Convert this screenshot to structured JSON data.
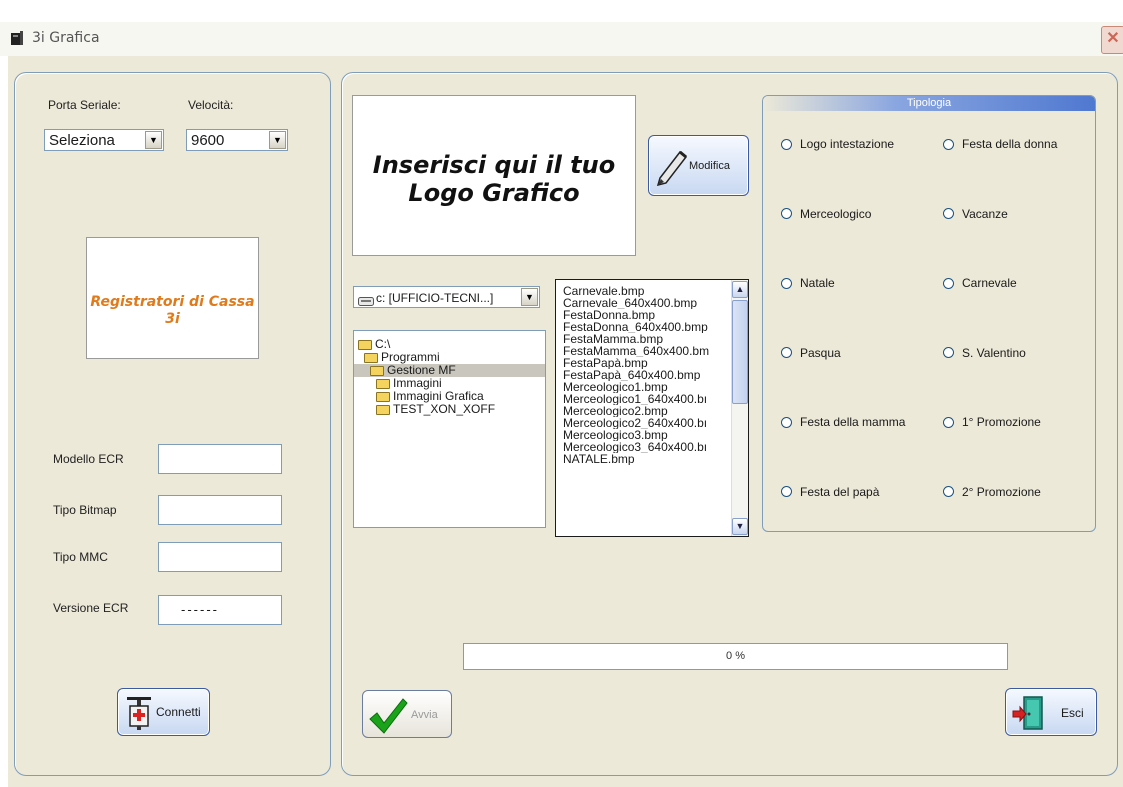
{
  "window": {
    "title": "3i Grafica",
    "close_glyph": "✕"
  },
  "connection": {
    "port_label": "Porta Seriale:",
    "port_value": "Seleziona",
    "speed_label": "Velocità:",
    "speed_value": "9600"
  },
  "brand": {
    "text": "Registratori di Cassa 3i"
  },
  "device_info": {
    "modello_label": "Modello ECR",
    "modello_value": "",
    "bitmap_label": "Tipo Bitmap",
    "bitmap_value": "",
    "mmc_label": "Tipo MMC",
    "mmc_value": "",
    "versione_label": "Versione ECR",
    "versione_value": "------"
  },
  "buttons": {
    "connetti": "Connetti",
    "modifica": "Modifica",
    "avvia": "Avvia",
    "esci": "Esci"
  },
  "logo_preview": {
    "line1": "Inserisci qui il tuo",
    "line2": "Logo Grafico"
  },
  "drive": {
    "value": "c: [UFFICIO-TECNI...]"
  },
  "folders": [
    {
      "label": "C:\\",
      "level": 0,
      "open": true
    },
    {
      "label": "Programmi",
      "level": 1,
      "open": true
    },
    {
      "label": "Gestione MF",
      "level": 2,
      "open": true,
      "selected": true
    },
    {
      "label": "Immagini",
      "level": 3,
      "open": false
    },
    {
      "label": "Immagini Grafica",
      "level": 3,
      "open": false
    },
    {
      "label": "TEST_XON_XOFF",
      "level": 3,
      "open": false
    }
  ],
  "files": [
    "Carnevale.bmp",
    "Carnevale_640x400.bmp",
    "FestaDonna.bmp",
    "FestaDonna_640x400.bmp",
    "FestaMamma.bmp",
    "FestaMamma_640x400.bm",
    "FestaPapà.bmp",
    "FestaPapà_640x400.bmp",
    "Merceologico1.bmp",
    "Merceologico1_640x400.bı",
    "Merceologico2.bmp",
    "Merceologico2_640x400.bı",
    "Merceologico3.bmp",
    "Merceologico3_640x400.bı",
    "NATALE.bmp"
  ],
  "tipologia": {
    "title": "Tipologia",
    "options": [
      [
        "Logo intestazione",
        "Festa della donna"
      ],
      [
        "Merceologico",
        "Vacanze"
      ],
      [
        "Natale",
        "Carnevale"
      ],
      [
        "Pasqua",
        "S. Valentino"
      ],
      [
        "Festa della mamma",
        "1° Promozione"
      ],
      [
        "Festa del papà",
        "2° Promozione"
      ]
    ]
  },
  "progress": {
    "label": "0 %",
    "fraction": 0
  },
  "colors": {
    "brand_text": "#e07a1a",
    "avvia_check": "#1aa31a"
  }
}
